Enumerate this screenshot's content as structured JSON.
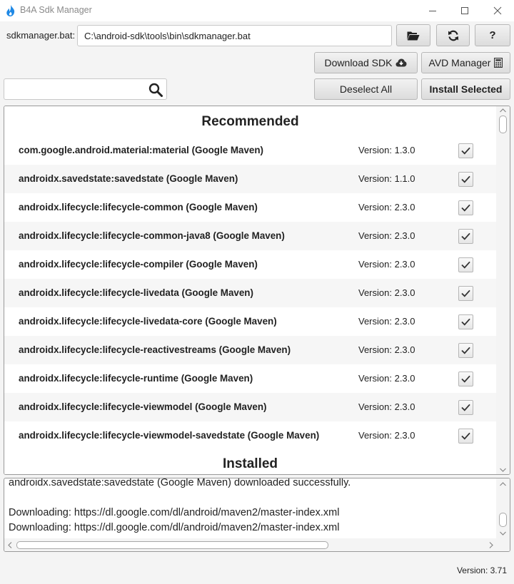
{
  "window": {
    "title": "B4A Sdk Manager",
    "icon": "b4a-flame-icon",
    "accent_color": "#1e88e5"
  },
  "toolbar": {
    "path_label": "sdkmanager.bat:",
    "path_value": "C:\\android-sdk\\tools\\bin\\sdkmanager.bat",
    "folder_icon": "folder-open-icon",
    "refresh_icon": "refresh-icon",
    "help_label": "?",
    "download_label": "Download SDK",
    "download_icon": "cloud-download-icon",
    "avd_label": "AVD Manager",
    "avd_icon": "calculator-icon",
    "deselect_label": "Deselect All",
    "install_label": "Install Selected"
  },
  "search": {
    "value": "",
    "placeholder": ""
  },
  "packages": {
    "recommended_title": "Recommended",
    "installed_title": "Installed",
    "rows": [
      {
        "name": "com.google.android.material:material (Google Maven)",
        "version": "Version: 1.3.0",
        "checked": true
      },
      {
        "name": "androidx.savedstate:savedstate (Google Maven)",
        "version": "Version: 1.1.0",
        "checked": true
      },
      {
        "name": "androidx.lifecycle:lifecycle-common (Google Maven)",
        "version": "Version: 2.3.0",
        "checked": true
      },
      {
        "name": "androidx.lifecycle:lifecycle-common-java8 (Google Maven)",
        "version": "Version: 2.3.0",
        "checked": true
      },
      {
        "name": "androidx.lifecycle:lifecycle-compiler (Google Maven)",
        "version": "Version: 2.3.0",
        "checked": true
      },
      {
        "name": "androidx.lifecycle:lifecycle-livedata (Google Maven)",
        "version": "Version: 2.3.0",
        "checked": true
      },
      {
        "name": "androidx.lifecycle:lifecycle-livedata-core (Google Maven)",
        "version": "Version: 2.3.0",
        "checked": true
      },
      {
        "name": "androidx.lifecycle:lifecycle-reactivestreams (Google Maven)",
        "version": "Version: 2.3.0",
        "checked": true
      },
      {
        "name": "androidx.lifecycle:lifecycle-runtime (Google Maven)",
        "version": "Version: 2.3.0",
        "checked": true
      },
      {
        "name": "androidx.lifecycle:lifecycle-viewmodel (Google Maven)",
        "version": "Version: 2.3.0",
        "checked": true
      },
      {
        "name": "androidx.lifecycle:lifecycle-viewmodel-savedstate (Google Maven)",
        "version": "Version: 2.3.0",
        "checked": true
      }
    ]
  },
  "log": {
    "lines": [
      "androidx.savedstate:savedstate (Google Maven) downloaded successfully.",
      "",
      "Downloading: https://dl.google.com/dl/android/maven2/master-index.xml",
      "Downloading: https://dl.google.com/dl/android/maven2/master-index.xml"
    ]
  },
  "footer": {
    "version": "Version: 3.71"
  }
}
